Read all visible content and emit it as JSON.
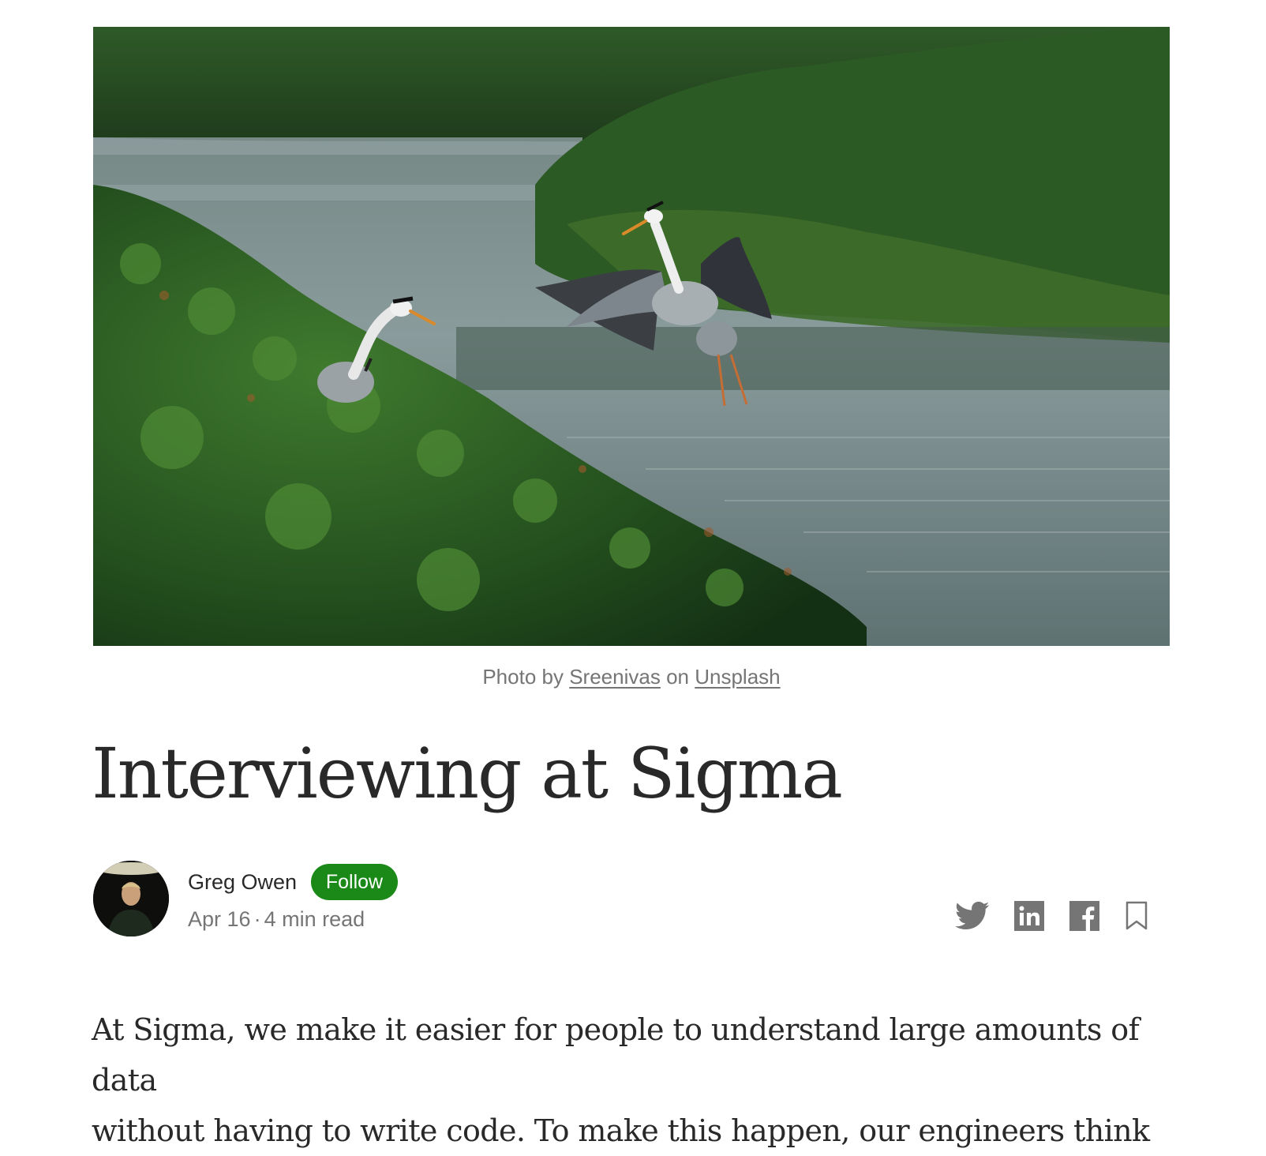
{
  "hero": {
    "image_alt": "Grey herons over a green wetland"
  },
  "caption": {
    "prefix": "Photo by",
    "photographer": "Sreenivas",
    "middle": "on",
    "source": "Unsplash"
  },
  "article": {
    "title": "Interviewing at Sigma",
    "author": "Greg Owen",
    "follow_label": "Follow",
    "date": "Apr 16",
    "separator": "·",
    "read_time": "4 min read",
    "body_line_1": "At Sigma, we make it easier for people to understand large amounts of data",
    "body_line_2": "without having to write code. To make this happen, our engineers think"
  },
  "share": {
    "icons": [
      "twitter-icon",
      "linkedin-icon",
      "facebook-icon",
      "bookmark-icon"
    ]
  },
  "colors": {
    "follow_green": "#1a8917",
    "icon_grey": "#757575",
    "text_dark": "#292929"
  }
}
